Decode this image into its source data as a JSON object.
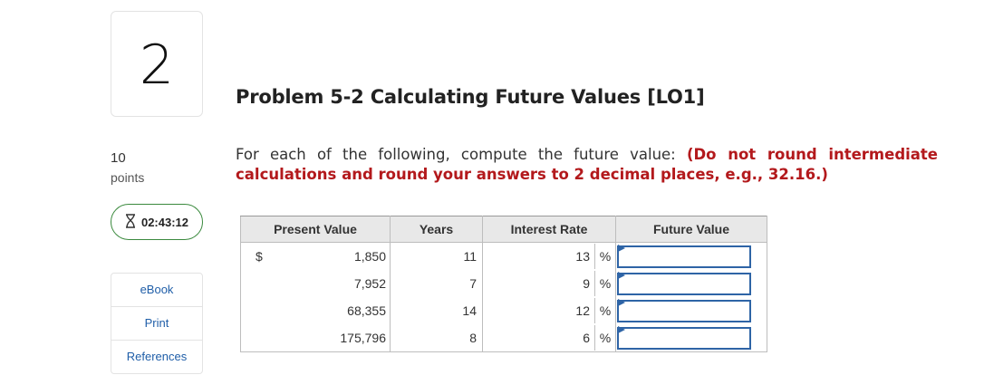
{
  "question": {
    "number": "2",
    "points_value": "10",
    "points_label": "points"
  },
  "timer": {
    "time": "02:43:12",
    "icon": "hourglass-icon"
  },
  "side_links": [
    {
      "label": "eBook"
    },
    {
      "label": "Print"
    },
    {
      "label": "References"
    }
  ],
  "problem": {
    "title": "Problem 5-2 Calculating Future Values [LO1]",
    "instruction_plain": "For each of the following, compute the future value: ",
    "instruction_bold": "(Do not round intermediate calculations and round your answers to 2 decimal places, e.g., 32.16.)"
  },
  "table": {
    "headers": [
      "Present Value",
      "Years",
      "Interest Rate",
      "Future Value"
    ],
    "currency_symbol": "$",
    "percent_symbol": "%",
    "rows": [
      {
        "present_value": "1,850",
        "years": "11",
        "rate": "13",
        "future_value": ""
      },
      {
        "present_value": "7,952",
        "years": "7",
        "rate": "9",
        "future_value": ""
      },
      {
        "present_value": "68,355",
        "years": "14",
        "rate": "12",
        "future_value": ""
      },
      {
        "present_value": "175,796",
        "years": "8",
        "rate": "6",
        "future_value": ""
      }
    ]
  },
  "colors": {
    "accent_blue": "#2e64a6",
    "instruction_red": "#b3191c",
    "timer_border": "#3b8a3e",
    "link_blue": "#1f5ea8"
  }
}
